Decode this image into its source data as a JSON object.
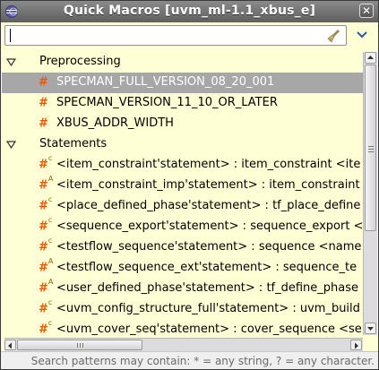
{
  "window": {
    "title": "Quick Macros [uvm_ml-1.1_xbus_e]",
    "close_glyph": "✕"
  },
  "search": {
    "value": "",
    "placeholder": ""
  },
  "groups": [
    {
      "label": "Preprocessing",
      "expanded": true,
      "items": [
        {
          "hash": "#",
          "sup": "",
          "label": "SPECMAN_FULL_VERSION_08_20_001",
          "selected": true
        },
        {
          "hash": "#",
          "sup": "",
          "label": "SPECMAN_VERSION_11_10_OR_LATER",
          "selected": false
        },
        {
          "hash": "#",
          "sup": "",
          "label": "XBUS_ADDR_WIDTH",
          "selected": false
        }
      ]
    },
    {
      "label": "Statements",
      "expanded": true,
      "items": [
        {
          "hash": "#",
          "sup": "c",
          "label": "<item_constraint'statement> : item_constraint <ite"
        },
        {
          "hash": "#",
          "sup": "A",
          "label": "<item_constraint_imp'statement> : item_constraint"
        },
        {
          "hash": "#",
          "sup": "c",
          "label": "<place_defined_phase'statement> : tf_place_define"
        },
        {
          "hash": "#",
          "sup": "c",
          "label": "<sequence_export'statement> : sequence_export <"
        },
        {
          "hash": "#",
          "sup": "c",
          "label": "<testflow_sequence'statement> : sequence <name"
        },
        {
          "hash": "#",
          "sup": "A",
          "label": "<testflow_sequence_ext'statement> : sequence_te"
        },
        {
          "hash": "#",
          "sup": "A",
          "label": "<user_defined_phase'statement> : tf_define_phase"
        },
        {
          "hash": "#",
          "sup": "c",
          "label": "<uvm_config_structure_full'statement> : uvm_build"
        },
        {
          "hash": "#",
          "sup": "c",
          "label": "<uvm_cover_seq'statement> : cover_sequence <se"
        }
      ]
    }
  ],
  "status": {
    "text": "Search patterns may contain: * = any string, ? = any character."
  },
  "colors": {
    "title_bar": "#6e6e6e",
    "list_background": "#ffffd6",
    "selection": "#a7a7a7",
    "hash_icon": "#e65a00"
  }
}
